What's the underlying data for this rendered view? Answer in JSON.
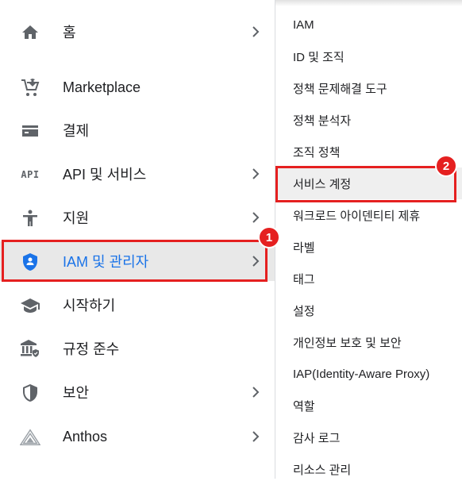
{
  "left_menu": {
    "items": [
      {
        "label": "홈",
        "icon": "home-icon"
      },
      {
        "label": "Marketplace",
        "icon": "cart-icon"
      },
      {
        "label": "결제",
        "icon": "credit-card-icon"
      },
      {
        "label": "API 및 서비스",
        "icon": "api-icon",
        "icon_text": "API"
      },
      {
        "label": "지원",
        "icon": "support-person-icon"
      },
      {
        "label": "IAM 및 관리자",
        "icon": "iam-shield-icon"
      },
      {
        "label": "시작하기",
        "icon": "graduation-cap-icon"
      },
      {
        "label": "규정 준수",
        "icon": "compliance-building-icon"
      },
      {
        "label": "보안",
        "icon": "security-shield-icon"
      },
      {
        "label": "Anthos",
        "icon": "anthos-icon"
      }
    ]
  },
  "submenu": {
    "items": [
      {
        "label": "IAM"
      },
      {
        "label": "ID 및 조직"
      },
      {
        "label": "정책 문제해결 도구"
      },
      {
        "label": "정책 분석자"
      },
      {
        "label": "조직 정책"
      },
      {
        "label": "서비스 계정"
      },
      {
        "label": "워크로드 아이덴티티 제휴"
      },
      {
        "label": "라벨"
      },
      {
        "label": "태그"
      },
      {
        "label": "설정"
      },
      {
        "label": "개인정보 보호 및 보안"
      },
      {
        "label": "IAP(Identity-Aware Proxy)"
      },
      {
        "label": "역할"
      },
      {
        "label": "감사 로그"
      },
      {
        "label": "리소스 관리"
      }
    ]
  },
  "annotations": {
    "badge_1": "1",
    "badge_2": "2"
  },
  "colors": {
    "accent": "#1a73e8",
    "highlight": "#e52020",
    "icon_gray": "#5f6368",
    "active_bg": "#e8e8e8"
  }
}
